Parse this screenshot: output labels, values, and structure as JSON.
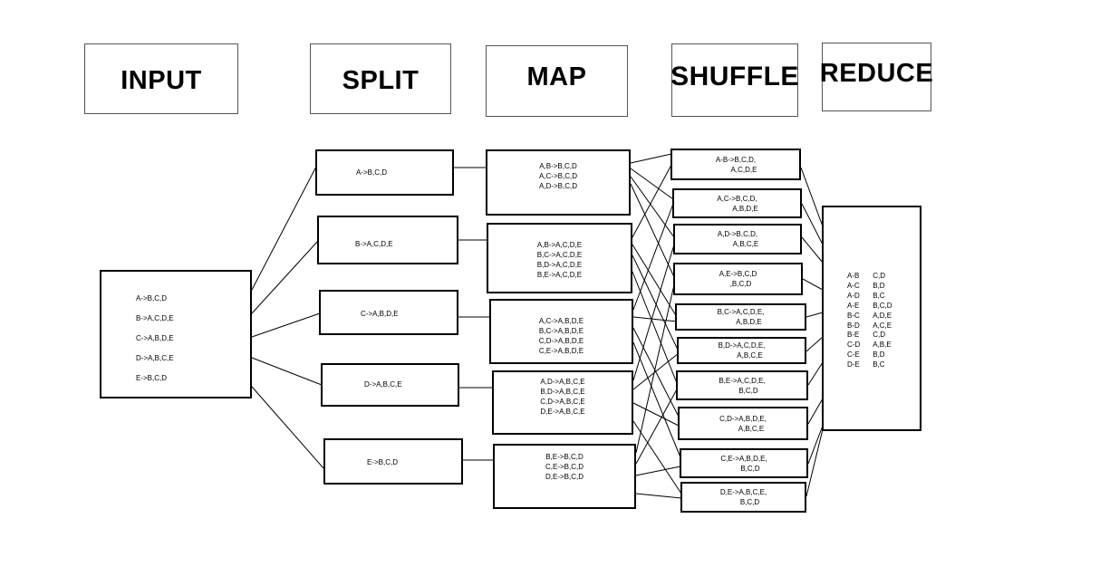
{
  "headers": {
    "input": "INPUT",
    "split": "SPLIT",
    "map": "MAP",
    "shuffle": "SHUFFLE",
    "reduce": "REDUCE"
  },
  "input": {
    "lines": [
      "A->B,C,D",
      "B->A,C,D,E",
      "C->A,B,D,E",
      "D->A,B,C,E",
      "E->B,C,D"
    ]
  },
  "split": [
    [
      "A->B,C,D"
    ],
    [
      "B->A,C,D,E"
    ],
    [
      "C->A,B,D,E"
    ],
    [
      "D->A,B,C,E"
    ],
    [
      "E->B,C,D"
    ]
  ],
  "map": [
    [
      "A,B->B,C,D",
      "A,C->B,C,D",
      "A,D->B,C,D"
    ],
    [
      "A,B->A,C,D,E",
      "B,C->A,C,D,E",
      "B,D->A,C,D,E",
      "B,E->A,C,D,E"
    ],
    [
      "A,C->A,B,D,E",
      "B,C->A,B,D,E",
      "C,D->A,B,D,E",
      "C,E->A,B,D,E"
    ],
    [
      "A,D->A,B,C,E",
      "B,D->A,B,C,E",
      "C,D->A,B,C,E",
      "D,E->A,B,C,E"
    ],
    [
      "B,E->B,C,D",
      "C,E->B,C,D",
      "D,E->B,C,D"
    ]
  ],
  "shuffle": [
    [
      "A-B->B,C,D,",
      "A,C,D,E"
    ],
    [
      "A,C->B,C,D,",
      "A,B,D,E"
    ],
    [
      "A,D->B,C,D,",
      "A,B,C,E"
    ],
    [
      "A,E->B,C,D",
      ",B,C,D"
    ],
    [
      "B,C->A,C,D,E,",
      "A,B,D,E"
    ],
    [
      "B,D->A,C,D,E,",
      "A,B,C,E"
    ],
    [
      "B,E->A,C,D,E,",
      "B,C,D"
    ],
    [
      "C,D->A,B,D,E,",
      "A,B,C,E"
    ],
    [
      "C,E->A,B,D,E,",
      "B,C,D"
    ],
    [
      "D,E->A,B,C,E,",
      "B,C,D"
    ]
  ],
  "reduce": {
    "rows": [
      {
        "pair": "A-B",
        "common": "C,D"
      },
      {
        "pair": "A-C",
        "common": "B,D"
      },
      {
        "pair": "A-D",
        "common": "B,C"
      },
      {
        "pair": "A-E",
        "common": "B,C,D"
      },
      {
        "pair": "B-C",
        "common": "A,D,E"
      },
      {
        "pair": "B-D",
        "common": "A,C,E"
      },
      {
        "pair": "B-E",
        "common": "C,D"
      },
      {
        "pair": "C-D",
        "common": "A,B,E"
      },
      {
        "pair": "C-E",
        "common": "B,D"
      },
      {
        "pair": "D-E",
        "common": "B,C"
      }
    ]
  },
  "colors": {
    "stroke": "#000000",
    "background": "#ffffff"
  }
}
